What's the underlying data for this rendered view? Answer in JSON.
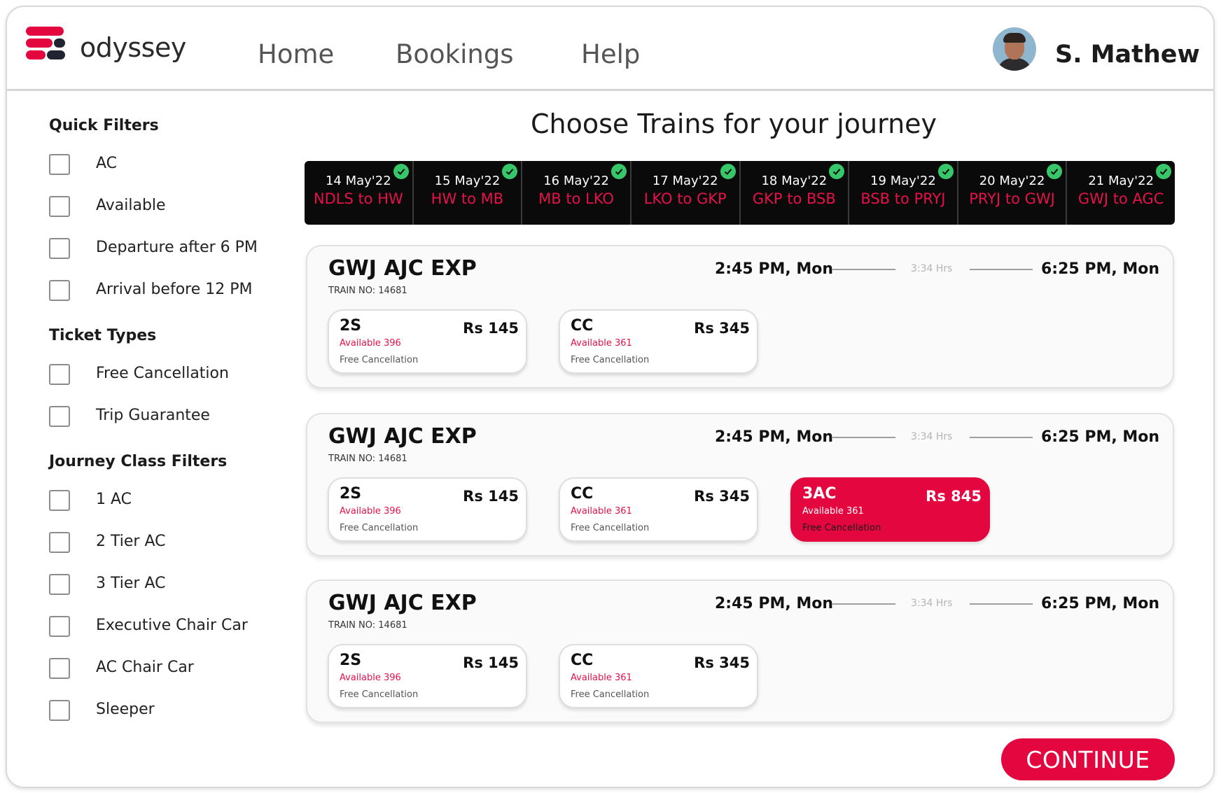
{
  "brand": {
    "name": "odyssey",
    "colors": {
      "accent": "#e3063f",
      "dark": "#1f2430"
    }
  },
  "nav": {
    "items": [
      "Home",
      "Bookings",
      "Help"
    ]
  },
  "user": {
    "name": "S. Mathew"
  },
  "sidebar": {
    "quick_filters": {
      "title": "Quick Filters",
      "items": [
        "AC",
        "Available",
        "Departure after 6 PM",
        "Arrival before 12 PM"
      ]
    },
    "ticket_types": {
      "title": "Ticket Types",
      "items": [
        "Free Cancellation",
        "Trip Guarantee"
      ]
    },
    "journey_class": {
      "title": "Journey Class Filters",
      "items": [
        "1 AC",
        "2 Tier AC",
        "3 Tier AC",
        "Executive Chair Car",
        "AC Chair Car",
        "Sleeper"
      ]
    }
  },
  "main": {
    "title": "Choose Trains for your journey",
    "dates": [
      {
        "date": "14 May'22",
        "route": "NDLS to HW",
        "done": true
      },
      {
        "date": "15 May'22",
        "route": "HW to MB",
        "done": true
      },
      {
        "date": "16 May'22",
        "route": "MB to LKO",
        "done": true
      },
      {
        "date": "17 May'22",
        "route": "LKO to GKP",
        "done": true
      },
      {
        "date": "18 May'22",
        "route": "GKP to BSB",
        "done": true
      },
      {
        "date": "19 May'22",
        "route": "BSB to PRYJ",
        "done": true
      },
      {
        "date": "20 May'22",
        "route": "PRYJ to GWJ",
        "done": true
      },
      {
        "date": "21 May'22",
        "route": "GWJ to AGC",
        "done": true
      }
    ],
    "trains": [
      {
        "name": "GWJ AJC EXP",
        "train_no": "TRAIN NO: 14681",
        "departure": "2:45 PM, Mon",
        "duration": "3:34 Hrs",
        "arrival": "6:25 PM, Mon",
        "classes": [
          {
            "name": "2S",
            "price": "Rs 145",
            "availability": "Available 396",
            "cancellation": "Free Cancellation",
            "selected": false
          },
          {
            "name": "CC",
            "price": "Rs 345",
            "availability": "Available 361",
            "cancellation": "Free Cancellation",
            "selected": false
          }
        ]
      },
      {
        "name": "GWJ AJC EXP",
        "train_no": "TRAIN NO: 14681",
        "departure": "2:45 PM, Mon",
        "duration": "3:34 Hrs",
        "arrival": "6:25 PM, Mon",
        "classes": [
          {
            "name": "2S",
            "price": "Rs 145",
            "availability": "Available 396",
            "cancellation": "Free Cancellation",
            "selected": false
          },
          {
            "name": "CC",
            "price": "Rs 345",
            "availability": "Available 361",
            "cancellation": "Free Cancellation",
            "selected": false
          },
          {
            "name": "3AC",
            "price": "Rs 845",
            "availability": "Available 361",
            "cancellation": "Free Cancellation",
            "selected": true
          }
        ]
      },
      {
        "name": "GWJ AJC EXP",
        "train_no": "TRAIN NO: 14681",
        "departure": "2:45 PM, Mon",
        "duration": "3:34 Hrs",
        "arrival": "6:25 PM, Mon",
        "classes": [
          {
            "name": "2S",
            "price": "Rs 145",
            "availability": "Available 396",
            "cancellation": "Free Cancellation",
            "selected": false
          },
          {
            "name": "CC",
            "price": "Rs 345",
            "availability": "Available 361",
            "cancellation": "Free Cancellation",
            "selected": false
          }
        ]
      }
    ],
    "continue_label": "CONTINUE"
  }
}
